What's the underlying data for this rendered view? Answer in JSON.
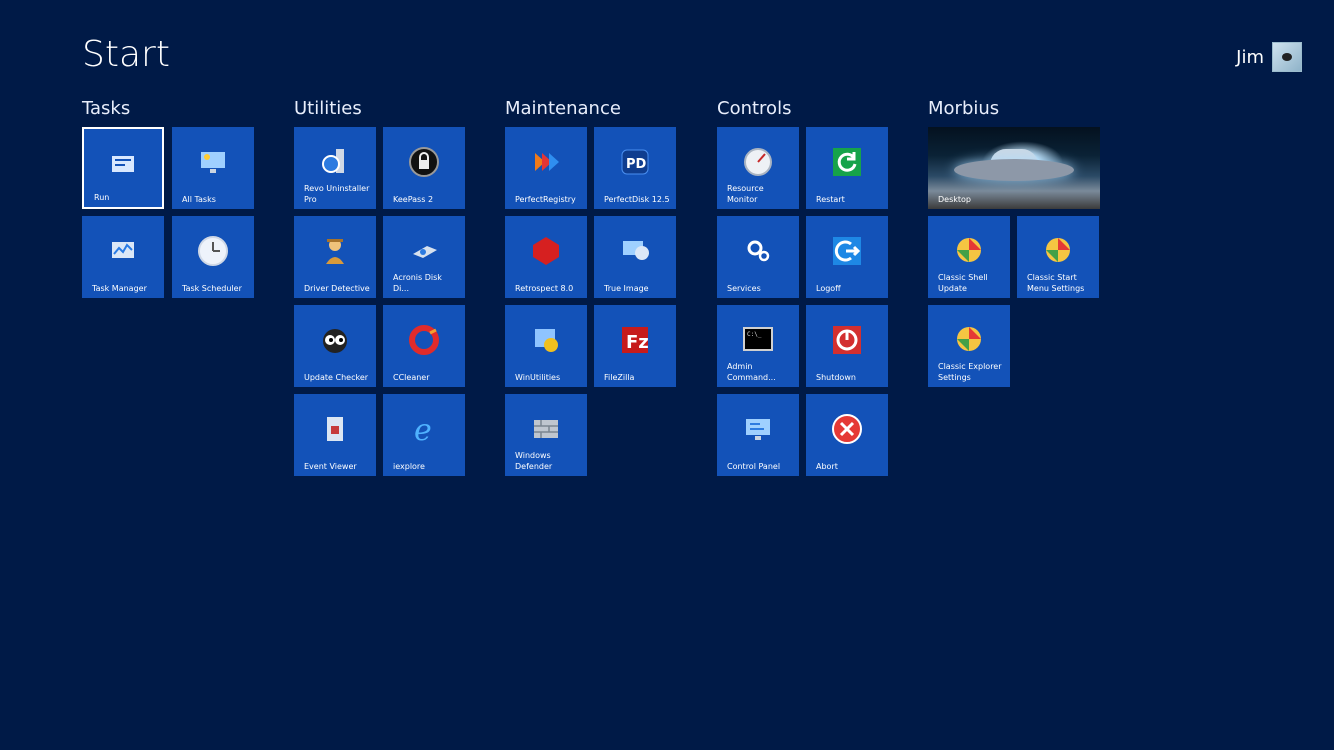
{
  "title": "Start",
  "user": {
    "name": "Jim"
  },
  "groups": {
    "tasks": "Tasks",
    "utilities": "Utilities",
    "maintenance": "Maintenance",
    "controls": "Controls",
    "morbius": "Morbius"
  },
  "tiles": {
    "run": "Run",
    "all_tasks": "All Tasks",
    "task_manager": "Task Manager",
    "task_scheduler": "Task Scheduler",
    "revo": "Revo Uninstaller\nPro",
    "keepass": "KeePass 2",
    "driver_detective": "Driver Detective",
    "acronis": "Acronis Disk Di...",
    "update_checker": "Update Checker",
    "ccleaner": "CCleaner",
    "event_viewer": "Event Viewer",
    "iexplore": "iexplore",
    "perfectregistry": "PerfectRegistry",
    "perfectdisk": "PerfectDisk 12.5",
    "retrospect": "Retrospect 8.0",
    "true_image": "True Image",
    "winutilities": "WinUtilities",
    "filezilla": "FileZilla",
    "defender": "Windows\nDefender",
    "resource_monitor": "Resource\nMonitor",
    "restart": "Restart",
    "services": "Services",
    "logoff": "Logoff",
    "admin_cmd": "Admin\nCommand...",
    "shutdown": "Shutdown",
    "control_panel": "Control Panel",
    "abort": "Abort",
    "desktop": "Desktop",
    "classic_shell_update": "Classic Shell\nUpdate",
    "classic_start": "Classic Start\nMenu Settings",
    "classic_explorer": "Classic Explorer\nSettings"
  }
}
